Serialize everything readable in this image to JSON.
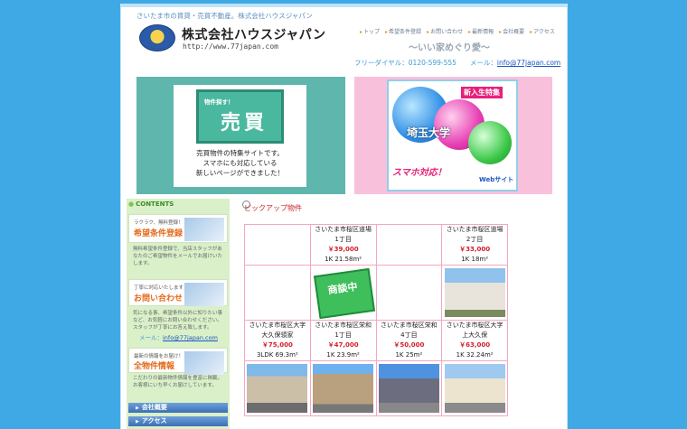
{
  "header": {
    "tagline": "さいたま市の賃貸・売買不動産。株式会社ハウスジャパン",
    "company": "株式会社ハウスジャパン",
    "url": "http://www.77japan.com",
    "slogan": "～いい家めぐり愛～",
    "contact_label": "フリーダイヤル：0120-599-555　　メール：",
    "email": "info@77japan.com",
    "nav": [
      "トップ",
      "希望条件登録",
      "お問い合わせ",
      "最新情報",
      "会社概要",
      "アクセス"
    ]
  },
  "banner_left": {
    "sign_small": "物件探す！",
    "sign_big": "売買",
    "lines": [
      "売買物件の特集サイトです。",
      "スマホにも対応している",
      "新しいページができました！"
    ]
  },
  "banner_right": {
    "badge": "新入生特集",
    "title": "埼玉大学",
    "smart": "スマホ対応！",
    "web": "Webサイト"
  },
  "sidebar": {
    "head": "CONTENTS",
    "box1_t1": "ラクラク、無料登録！",
    "box1_t2": "希望条件登録",
    "box1_desc": "無料希望条件登録で、当店スタッフがあなたのご希望物件をメールでお届けいたします。",
    "box2_t1": "丁寧に対応いたします",
    "box2_t2": "お問い合わせ",
    "box2_desc": "気になる事、希望条件以外に知りたい事など、お気軽にお問い合わせください。スタッフが丁寧にお答え致します。",
    "mail_label": "メール：",
    "mail": "info@77japan.com",
    "box3_t1": "最新の情報をお届け！",
    "box3_t2": "全物件情報",
    "box3_desc": "こだわりの最新物件情報を豊富に掲載。お客様にいち早くお届けしています。",
    "nav1": "会社概要",
    "nav2": "アクセス"
  },
  "pickup": {
    "title": "ピックアップ物件",
    "stamp": "商談中",
    "listings": [
      {
        "loc1": "さいたま市桜区道場",
        "loc2": "1丁目",
        "price": "￥39,000",
        "spec": "1K 21.58m²"
      },
      {
        "loc1": "さいたま市桜区道場",
        "loc2": "2丁目",
        "price": "￥33,000",
        "spec": "1K 18m²"
      },
      {
        "loc1": "さいたま市桜区大字",
        "loc2": "大久保領家",
        "price": "￥75,000",
        "spec": "3LDK 69.3m²"
      },
      {
        "loc1": "さいたま市桜区栄和",
        "loc2": "1丁目",
        "price": "￥47,000",
        "spec": "1K 23.9m²"
      },
      {
        "loc1": "さいたま市桜区栄和",
        "loc2": "4丁目",
        "price": "￥50,000",
        "spec": "1K 25m²"
      },
      {
        "loc1": "さいたま市桜区大字",
        "loc2": "上大久保",
        "price": "￥63,000",
        "spec": "1K 32.24m²"
      }
    ]
  }
}
